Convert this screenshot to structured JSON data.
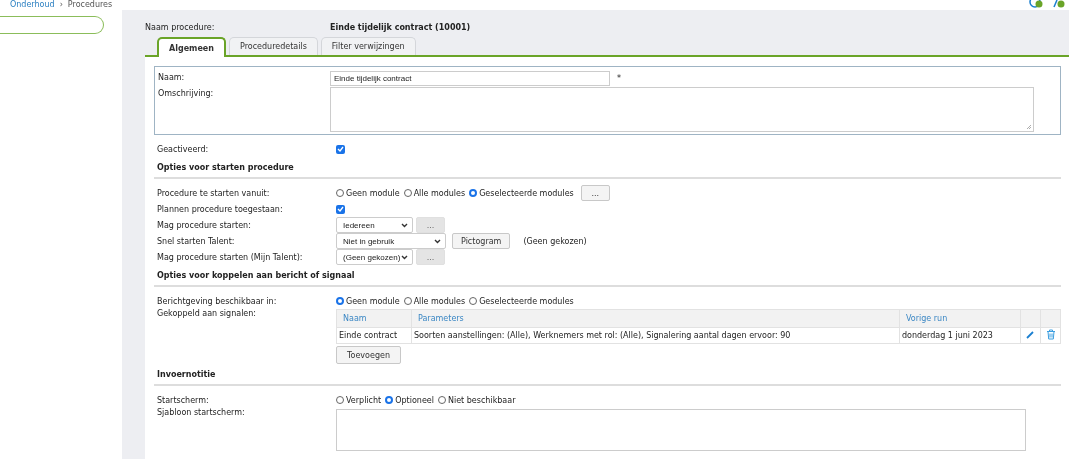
{
  "breadcrumb": [
    {
      "label": "Onderhoud",
      "link": true
    },
    {
      "label": "›",
      "link": false
    },
    {
      "label": "Procedures",
      "link": false
    }
  ],
  "procedure_name": {
    "label": "Naam procedure:",
    "value": "Einde tijdelijk contract (10001)"
  },
  "tabs": [
    {
      "label": "Algemeen",
      "selected": true
    },
    {
      "label": "Proceduredetails",
      "selected": false
    },
    {
      "label": "Filter verwijzingen",
      "selected": false
    }
  ],
  "name_field": {
    "label": "Naam:",
    "value": "Einde tijdelijk contract",
    "required_mark": "*"
  },
  "description_field": {
    "label": "Omschrijving:"
  },
  "activated": {
    "label": "Geactiveerd:",
    "checked": true
  },
  "sections": [
    {
      "title": "Opties voor starten procedure",
      "rows": [
        {
          "kind": "radio",
          "label": "Procedure te starten vanuit:",
          "options": [
            {
              "label": "Geen module",
              "selected": false
            },
            {
              "label": "Alle modules",
              "selected": false
            },
            {
              "label": "Geselecteerde modules",
              "selected": true
            }
          ],
          "button": {
            "label": "...",
            "disabled": false
          }
        },
        {
          "kind": "checkbox",
          "label": "Plannen procedure toegestaan:",
          "checked": true
        },
        {
          "kind": "select",
          "label": "Mag procedure starten:",
          "value": "Iedereen",
          "button": {
            "label": "...",
            "disabled": true
          }
        },
        {
          "kind": "select",
          "label": "Snel starten Talent:",
          "value": "Niet in gebruik",
          "wide": true,
          "button": {
            "label": "Pictogram",
            "disabled": false
          },
          "note": "(Geen gekozen)"
        },
        {
          "kind": "select",
          "label": "Mag procedure starten (Mijn Talent):",
          "value": "(Geen gekozen)",
          "button": {
            "label": "...",
            "disabled": true
          }
        }
      ]
    },
    {
      "title": "Opties voor koppelen aan bericht of signaal",
      "rows": [
        {
          "kind": "radio",
          "label": "Berichtgeving beschikbaar in:",
          "options": [
            {
              "label": "Geen module",
              "selected": true
            },
            {
              "label": "Alle modules",
              "selected": false
            },
            {
              "label": "Geselecteerde modules",
              "selected": false
            }
          ]
        },
        {
          "kind": "table",
          "label": "Gekoppeld aan signalen:",
          "columns": [
            "Naam",
            "Parameters",
            "Vorige run"
          ],
          "rows": [
            {
              "cells": [
                "Einde contract",
                "Soorten aanstellingen: (Alle), Werknemers met rol: (Alle), Signalering aantal dagen ervoor: 90",
                "donderdag 1 juni 2023"
              ]
            }
          ],
          "add_button": "Toevoegen"
        }
      ]
    },
    {
      "title": "Invoernotitie",
      "rows": [
        {
          "kind": "radio",
          "label": "Startscherm:",
          "options": [
            {
              "label": "Verplicht",
              "selected": false
            },
            {
              "label": "Optioneel",
              "selected": true
            },
            {
              "label": "Niet beschikbaar",
              "selected": false
            }
          ]
        },
        {
          "kind": "textarea",
          "label": "Sjabloon startscherm:"
        }
      ]
    }
  ]
}
